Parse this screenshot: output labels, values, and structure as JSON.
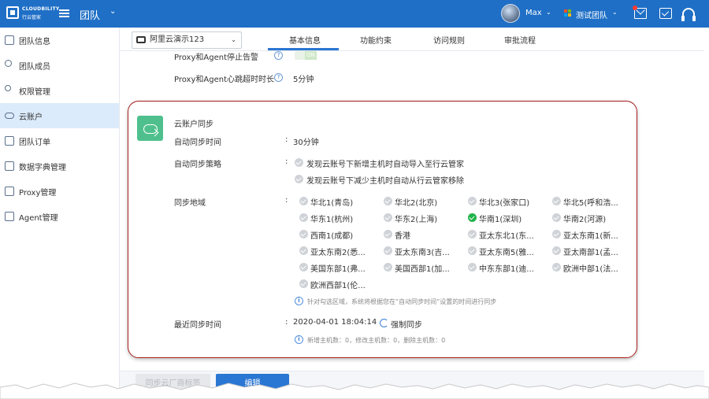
{
  "brand": {
    "logo_text_en": "CLOUDBILITY",
    "logo_text_cn": "行云管家"
  },
  "header": {
    "section_title": "团队",
    "user_name": "Max",
    "team_name": "测试团队"
  },
  "colors": {
    "primary": "#1f6fc6",
    "accent": "#2a76d3",
    "success": "#21b34b",
    "card_border": "#a51d1d",
    "sidebar_active": "#dcebfb"
  },
  "sidebar": {
    "items": [
      {
        "label": "团队信息",
        "icon": "document-icon"
      },
      {
        "label": "团队成员",
        "icon": "people-icon"
      },
      {
        "label": "权限管理",
        "icon": "key-icon"
      },
      {
        "label": "云账户",
        "icon": "cloud-icon",
        "active": true
      },
      {
        "label": "团队订单",
        "icon": "order-icon"
      },
      {
        "label": "数据字典管理",
        "icon": "dictionary-icon"
      },
      {
        "label": "Proxy管理",
        "icon": "proxy-icon"
      },
      {
        "label": "Agent管理",
        "icon": "agent-icon"
      }
    ]
  },
  "account_select": {
    "value": "阿里云演示123"
  },
  "tabs": [
    {
      "label": "基本信息",
      "active": true
    },
    {
      "label": "功能约束"
    },
    {
      "label": "访问规则"
    },
    {
      "label": "审批流程"
    }
  ],
  "settings": {
    "alarm_label": "Proxy和Agent停止告警",
    "alarm_switch_text": "ON",
    "heartbeat_label": "Proxy和Agent心跳超时时长",
    "heartbeat_value": "5分钟"
  },
  "sync": {
    "title": "云账户同步",
    "auto_time_label": "自动同步时间",
    "auto_time_value": "30分钟",
    "policy_label": "自动同步策略",
    "policies": [
      "发现云账号下新增主机时自动导入至行云管家",
      "发现云账号下减少主机时自动从行云管家移除"
    ],
    "regions_label": "同步地域",
    "regions": [
      {
        "label": "华北1(青岛)",
        "checked": false
      },
      {
        "label": "华北2(北京)",
        "checked": false
      },
      {
        "label": "华北3(张家口)",
        "checked": false
      },
      {
        "label": "华北5(呼和浩...",
        "checked": false
      },
      {
        "label": "华东1(杭州)",
        "checked": false
      },
      {
        "label": "华东2(上海)",
        "checked": false
      },
      {
        "label": "华南1(深圳)",
        "checked": true
      },
      {
        "label": "华南2(河源)",
        "checked": false
      },
      {
        "label": "西南1(成都)",
        "checked": false
      },
      {
        "label": "香港",
        "checked": false
      },
      {
        "label": "亚太东北1(东...",
        "checked": false
      },
      {
        "label": "亚太东南1(新...",
        "checked": false
      },
      {
        "label": "亚太东南2(悉...",
        "checked": false
      },
      {
        "label": "亚太东南3(吉...",
        "checked": false
      },
      {
        "label": "亚太东南5(雅...",
        "checked": false
      },
      {
        "label": "亚太南部1(孟...",
        "checked": false
      },
      {
        "label": "美国东部1(弗...",
        "checked": false
      },
      {
        "label": "美国西部1(加...",
        "checked": false
      },
      {
        "label": "中东东部1(迪...",
        "checked": false
      },
      {
        "label": "欧洲中部1(法...",
        "checked": false
      },
      {
        "label": "欧洲西部1(伦...",
        "checked": false
      }
    ],
    "region_hint": "针对勾选区域，系统将根据您在“自动同步时间”设置的时间进行同步",
    "last_time_label": "最近同步时间",
    "last_time_value": "2020-04-01 18:04:14",
    "force_sync_label": "强制同步",
    "last_sync_stats": "新增主机数：0，修改主机数：0，删除主机数：0"
  },
  "footer": {
    "sync_tags_button": "同步云厂商标签",
    "edit_button": "编辑"
  }
}
